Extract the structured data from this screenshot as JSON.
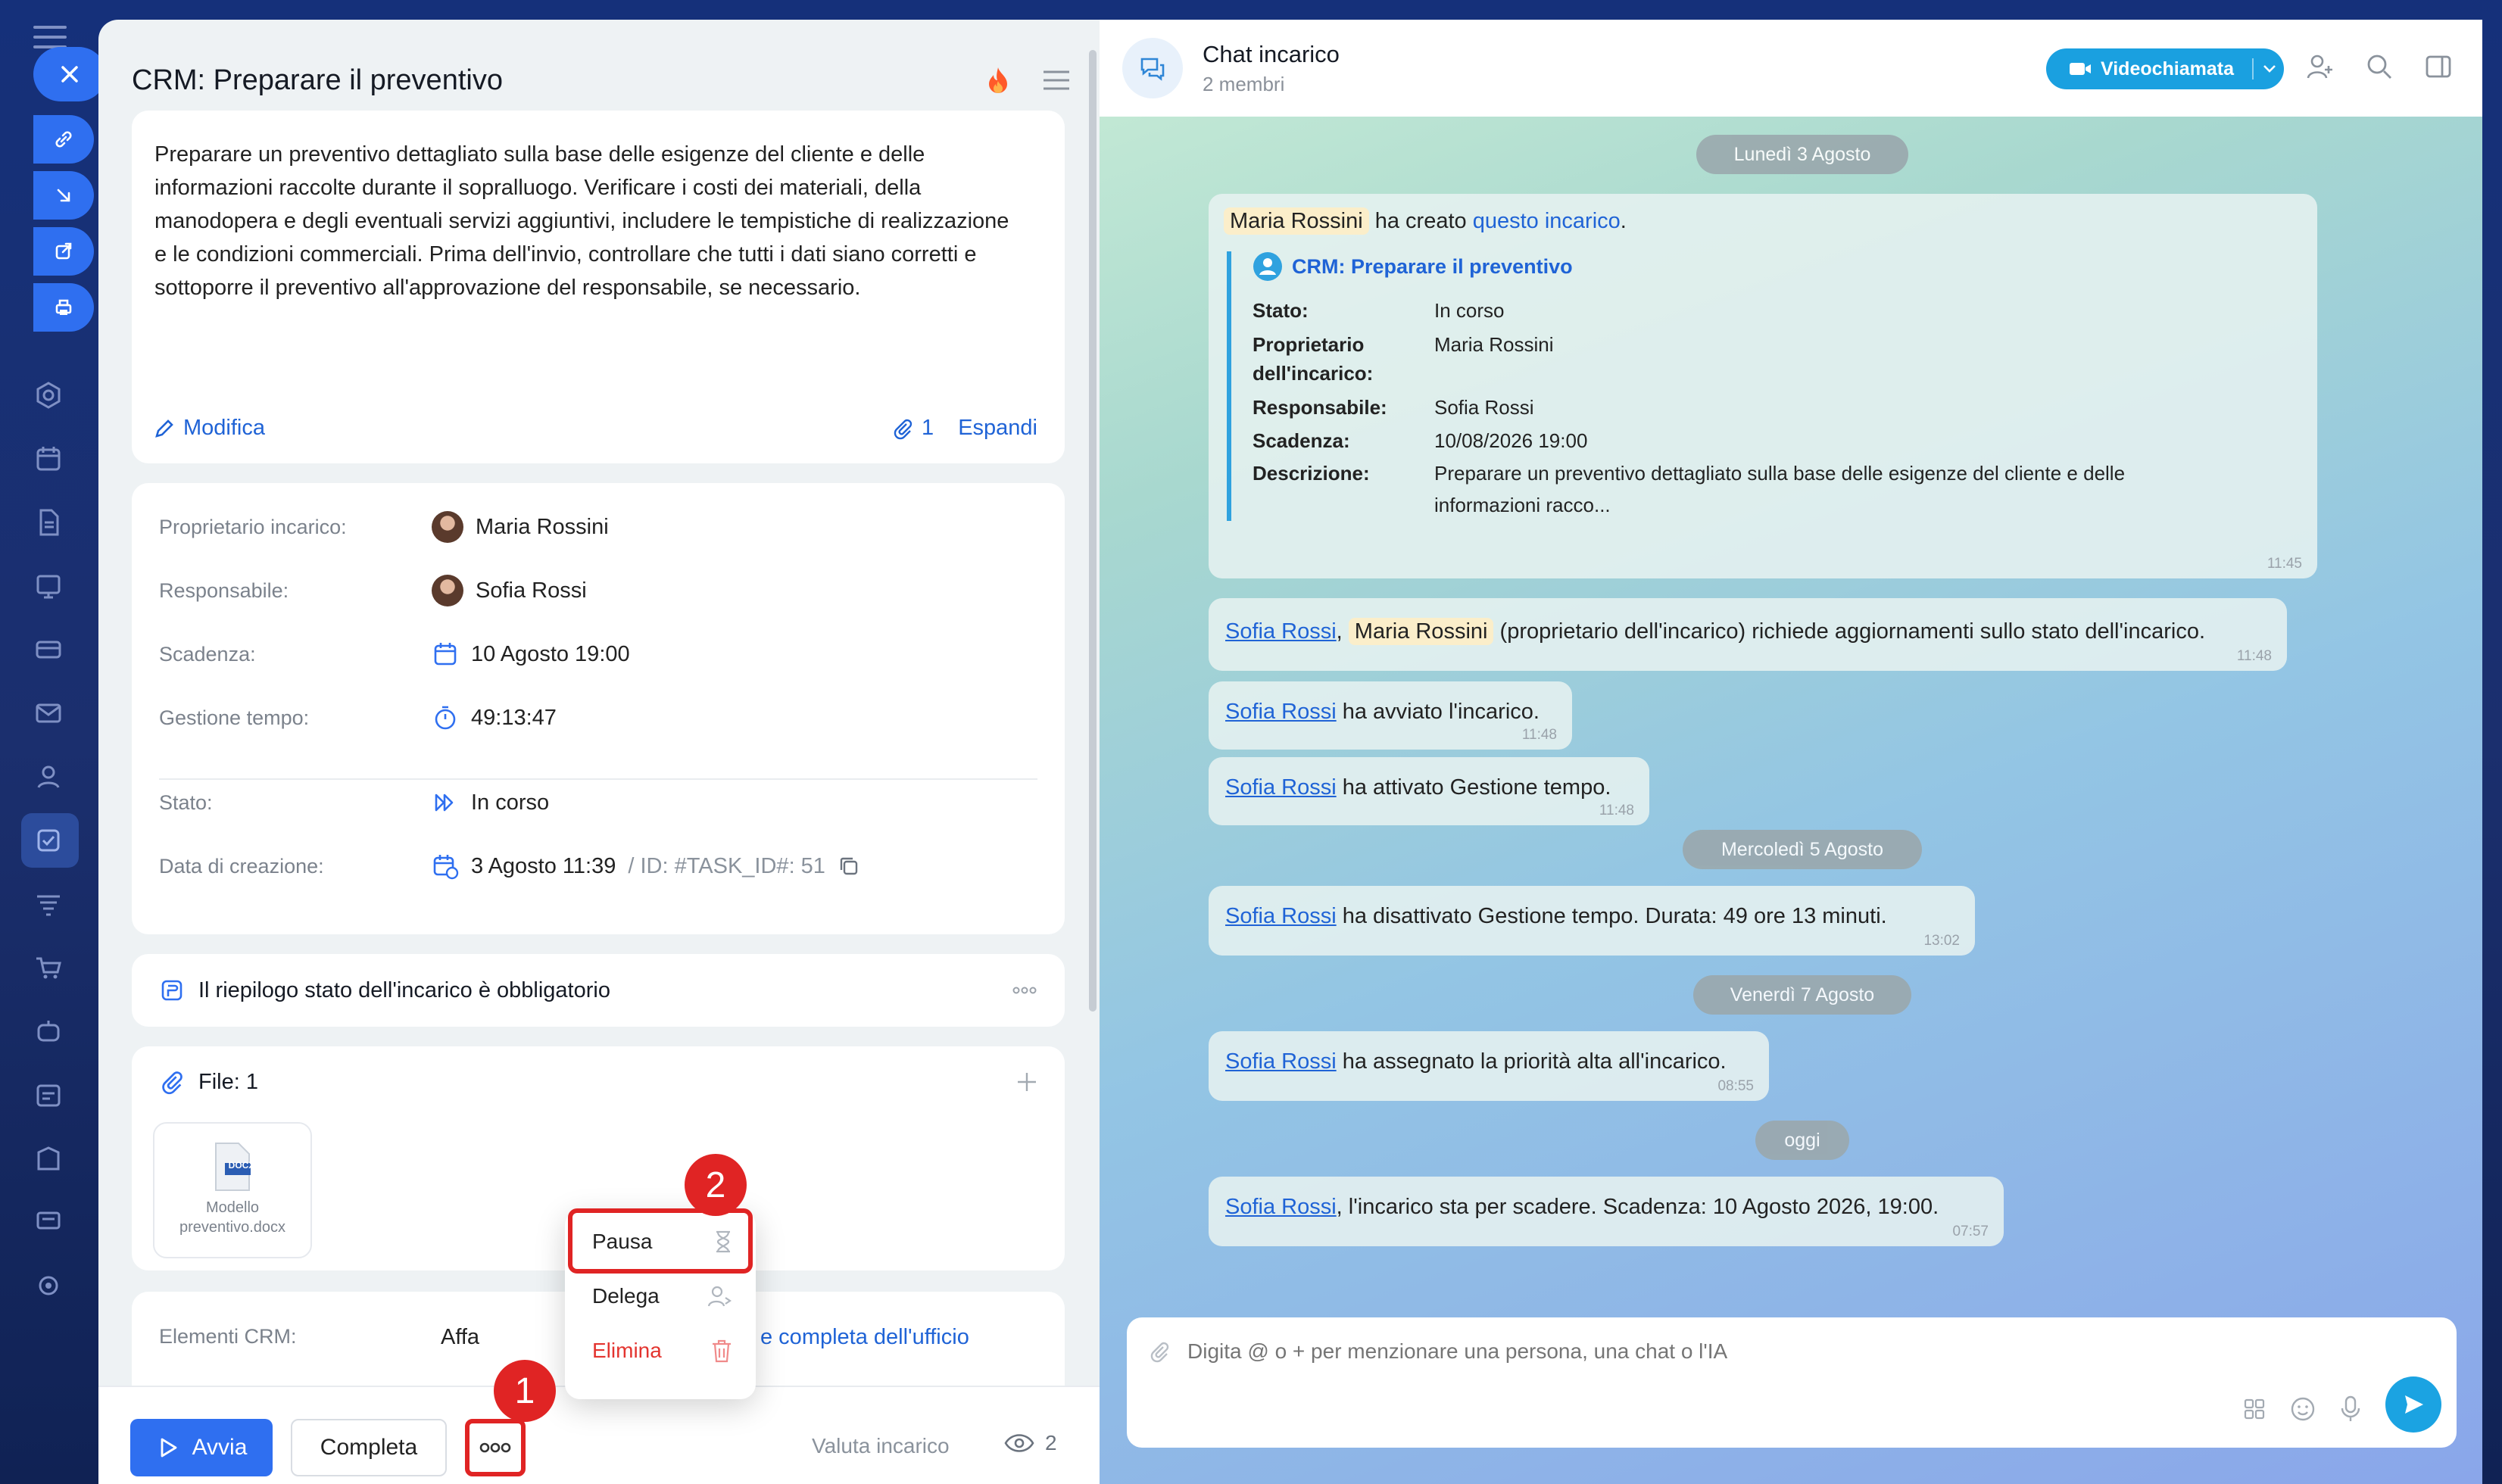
{
  "task": {
    "title": "CRM: Preparare il preventivo",
    "description": "Preparare un preventivo dettagliato sulla base delle esigenze del cliente e delle informazioni raccolte durante il sopralluogo. Verificare i costi dei materiali, della manodopera e degli eventuali servizi aggiuntivi, includere le tempistiche di realizzazione e le condizioni commerciali. Prima dell'invio, controllare che tutti i dati siano corretti e sottoporre il preventivo all'approvazione del responsabile, se necessario.",
    "edit_label": "Modifica",
    "attach_count": "1",
    "expand_label": "Espandi",
    "fields": [
      {
        "label": "Proprietario incarico:",
        "value": "Maria Rossini"
      },
      {
        "label": "Responsabile:",
        "value": "Sofia Rossi"
      },
      {
        "label": "Scadenza:",
        "value": "10 Agosto 19:00"
      },
      {
        "label": "Gestione tempo:",
        "value": "49:13:47"
      },
      {
        "label": "Stato:",
        "value": "In corso"
      },
      {
        "label": "Data di creazione:",
        "value": "3 Agosto 11:39",
        "extra": "/ ID: #TASK_ID#: 51"
      }
    ],
    "summary_label": "Il riepilogo stato dell'incarico è obbligatorio",
    "files_label": "File: 1",
    "file_name": "Modello preventivo.docx",
    "file_ext": "DOCX",
    "crm_label": "Elementi CRM:",
    "crm_value_start": "Affa",
    "crm_value_end": "e completa dell'ufficio",
    "buttons": {
      "start": "Avvia",
      "complete": "Completa",
      "rate": "Valuta incarico",
      "viewers": "2"
    },
    "menu": [
      {
        "label": "Pausa"
      },
      {
        "label": "Delega"
      },
      {
        "label": "Elimina"
      }
    ],
    "badges": [
      "1",
      "2"
    ]
  },
  "chat": {
    "title": "Chat incarico",
    "members": "2 membri",
    "video_label": "Videochiamata",
    "dates": [
      "Lunedì 3 Agosto",
      "Mercoledì 5 Agosto",
      "Venerdì 7 Agosto",
      "oggi"
    ],
    "created": {
      "author": "Maria Rossini",
      "text": "ha creato",
      "link": "questo incarico",
      "punct": ".",
      "task_title": "CRM: Preparare il preventivo",
      "rows": [
        {
          "k": "Stato:",
          "v": "In corso"
        },
        {
          "k": "Proprietario dell'incarico:",
          "v": "Maria Rossini"
        },
        {
          "k": "Responsabile:",
          "v": "Sofia Rossi"
        },
        {
          "k": "Scadenza:",
          "v": "10/08/2026 19:00"
        },
        {
          "k": "Descrizione:",
          "v": "Preparare un preventivo dettagliato sulla base delle esigenze del cliente e delle informazioni racco..."
        }
      ],
      "time": "11:45"
    },
    "messages": [
      {
        "user": "Sofia Rossi",
        "sep": ",",
        "mention": "Maria Rossini",
        "text": "(proprietario dell'incarico) richiede aggiornamenti sullo stato dell'incarico.",
        "time": "11:48"
      },
      {
        "user": "Sofia Rossi",
        "text": "ha avviato l'incarico.",
        "time": "11:48"
      },
      {
        "user": "Sofia Rossi",
        "text": "ha attivato Gestione tempo.",
        "time": "11:48"
      },
      {
        "user": "Sofia Rossi",
        "text": "ha disattivato Gestione tempo. Durata: 49 ore 13 minuti.",
        "time": "13:02"
      },
      {
        "user": "Sofia Rossi",
        "text": "ha assegnato la priorità alta all'incarico.",
        "time": "08:55"
      },
      {
        "user": "Sofia Rossi",
        "text": ", l'incarico sta per scadere. Scadenza: 10 Agosto 2026, 19:00.",
        "time": "07:57"
      }
    ],
    "input_placeholder": "Digita @ o + per menzionare una persona, una chat o l'IA"
  },
  "colors": {
    "accent": "#2f6ff0",
    "danger": "#e02424",
    "chat_accent": "#1aa0e0"
  }
}
